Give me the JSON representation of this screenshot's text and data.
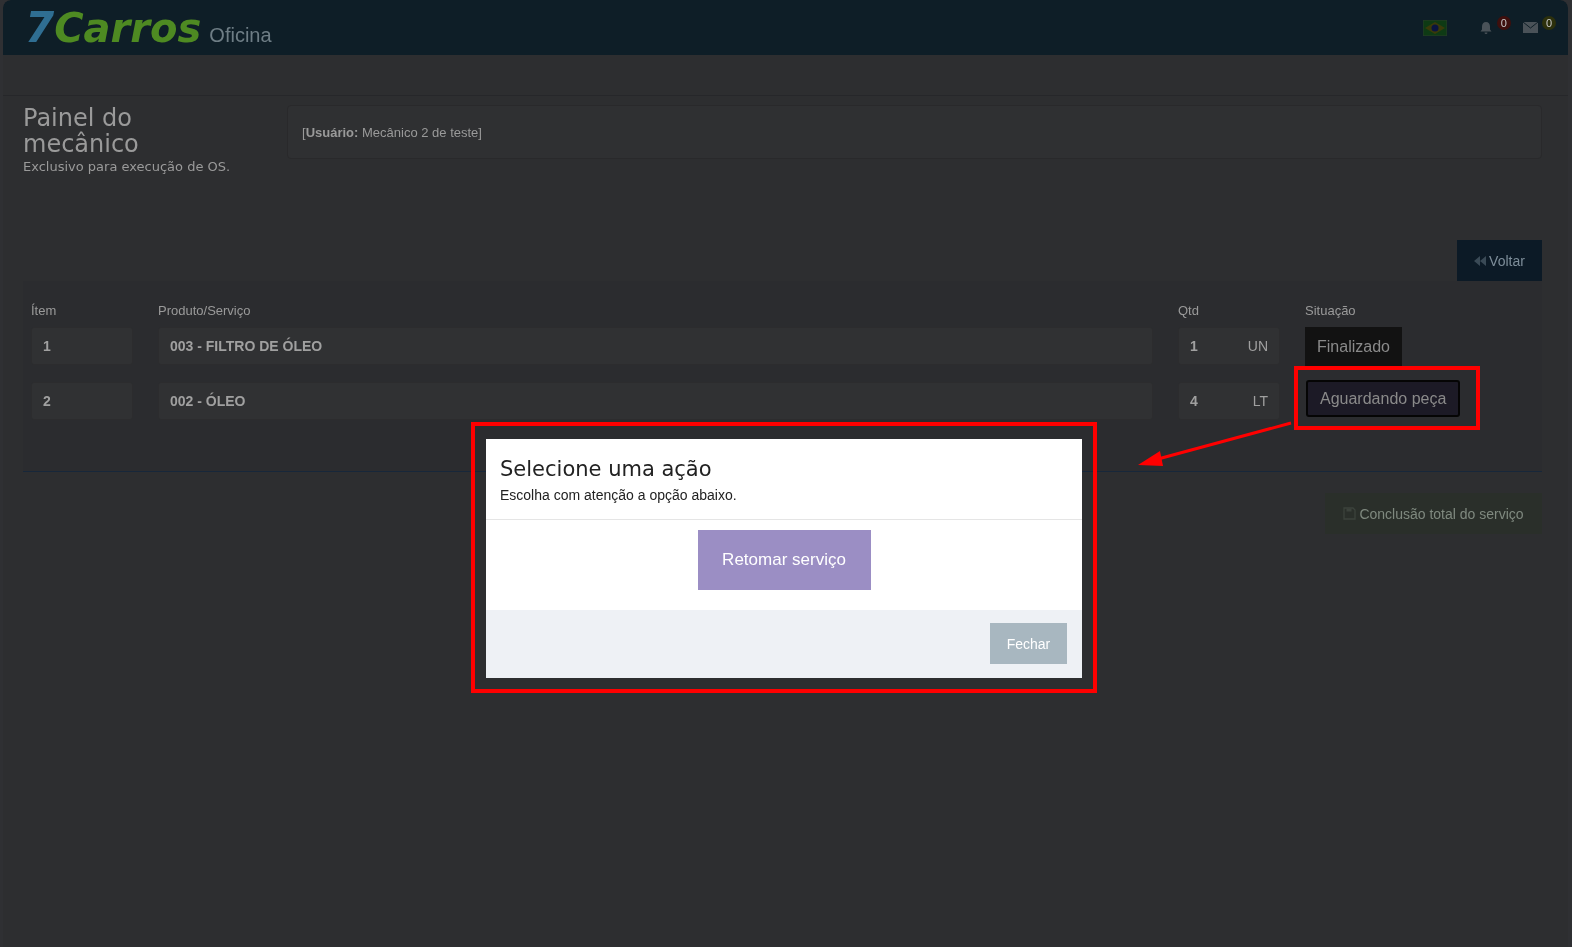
{
  "header": {
    "logo_number": "7",
    "logo_word": "Carros",
    "logo_suffix": "Oficina",
    "notifications": {
      "count": "0"
    },
    "messages": {
      "count": "0"
    }
  },
  "page": {
    "title": "Painel do mecânico",
    "subtitle": "Exclusivo para execução de OS.",
    "user_info": "[**Usuário:** Mecânico 2 de teste]",
    "back_button": "Voltar"
  },
  "table": {
    "columns": [
      "Ítem",
      "Produto/Serviço",
      "Qtd",
      "Situação"
    ],
    "rows": [
      {
        "item": "1",
        "product": "003 - FILTRO DE ÓLEO",
        "qty": "1",
        "unit": "UN",
        "status": "Finalizado",
        "kind": "done",
        "highlighted": false
      },
      {
        "item": "2",
        "product": "002 - ÓLEO",
        "qty": "4",
        "unit": "LT",
        "status": "Aguardando peça",
        "kind": "waiting",
        "highlighted": true
      }
    ]
  },
  "complete_button": "Conclusão total do serviço",
  "modal": {
    "title": "Selecione uma ação",
    "subtitle": "Escolha com atenção a opção abaixo.",
    "action_button": "Retomar serviço",
    "close_button": "Fechar",
    "highlighted": true
  }
}
